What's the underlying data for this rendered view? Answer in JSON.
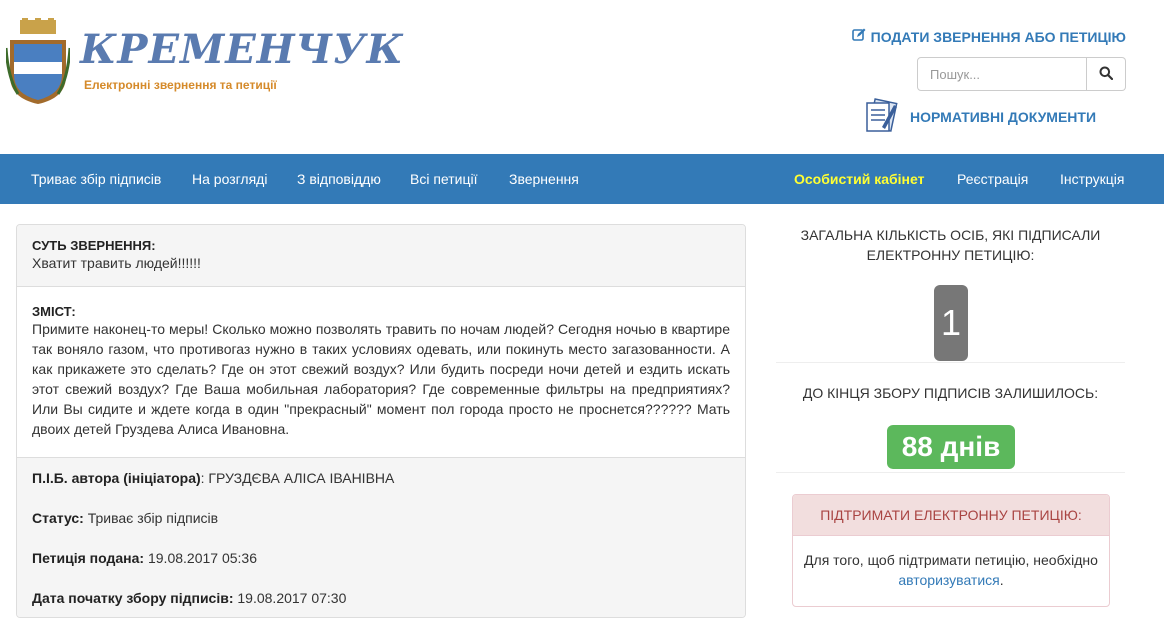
{
  "header": {
    "logo_title": "КРЕМЕНЧУК",
    "logo_subtitle": "Електронні звернення та петиції",
    "petition_link": "ПОДАТИ ЗВЕРНЕННЯ АБО ПЕТИЦІЮ",
    "search_placeholder": "Пошук...",
    "docs_link": "НОРМАТИВНІ ДОКУМЕНТИ"
  },
  "nav": {
    "left": [
      "Триває збір підписів",
      "На розгляді",
      "З відповіддю",
      "Всі петиції",
      "Звернення"
    ],
    "cabinet": "Особистий кабінет",
    "register": "Реєстрація",
    "instructions": "Інструкція"
  },
  "petition": {
    "subject_title": "СУТЬ ЗВЕРНЕННЯ:",
    "subject_text": "Хватит травить людей!!!!!!",
    "content_title": "ЗМІСТ:",
    "content_text": "Примите наконец-то меры! Сколько можно позволять травить по ночам людей? Сегодня ночью в квартире так воняло газом, что противогаз нужно в таких условиях одевать, или покинуть место загазованности. А как прикажете это сделать? Где он этот свежий воздух? Или будить посреди ночи детей и ездить искать этот свежий воздух? Где Ваша мобильная лаборатория? Где современные фильтры на предприятиях? Или Вы сидите и ждете когда в один \"прекрасный\" момент пол города просто не проснется?????? Мать двоих детей Груздева Алиса Ивановна.",
    "author_label": "П.І.Б. автора (ініціатора)",
    "author_value": ": ГРУЗДЄВА АЛІСА ІВАНІВНА",
    "status_label": "Статус:",
    "status_value": " Триває збір підписів",
    "submitted_label": "Петиція подана:",
    "submitted_value": " 19.08.2017 05:36",
    "start_label": "Дата початку збору підписів:",
    "start_value": " 19.08.2017 07:30"
  },
  "stats": {
    "signers_label": "ЗАГАЛЬНА КІЛЬКІСТЬ ОСІБ, ЯКІ ПІДПИСАЛИ ЕЛЕКТРОННУ ПЕТИЦІЮ:",
    "signers_count": "1",
    "remaining_label": "ДО КІНЦЯ ЗБОРУ ПІДПИСІВ ЗАЛИШИЛОСЬ:",
    "remaining_days": "88 днів"
  },
  "support": {
    "title": "ПІДТРИМАТИ ЕЛЕКТРОННУ ПЕТИЦІЮ:",
    "text_before": "Для того, щоб підтримати петицію, необхідно ",
    "login_link": "авторизуватися",
    "text_after": "."
  },
  "colors": {
    "navbar": "#337ab7",
    "link": "#337ab7",
    "highlight": "#ffff33",
    "success": "#5cb85c",
    "badge_gray": "#777777",
    "danger_text": "#a94442",
    "danger_bg": "#f2dede"
  },
  "icons": {
    "emblem": "city-coat-of-arms-icon",
    "petition": "edit-square-icon",
    "search": "search-icon",
    "docs": "documents-icon"
  }
}
